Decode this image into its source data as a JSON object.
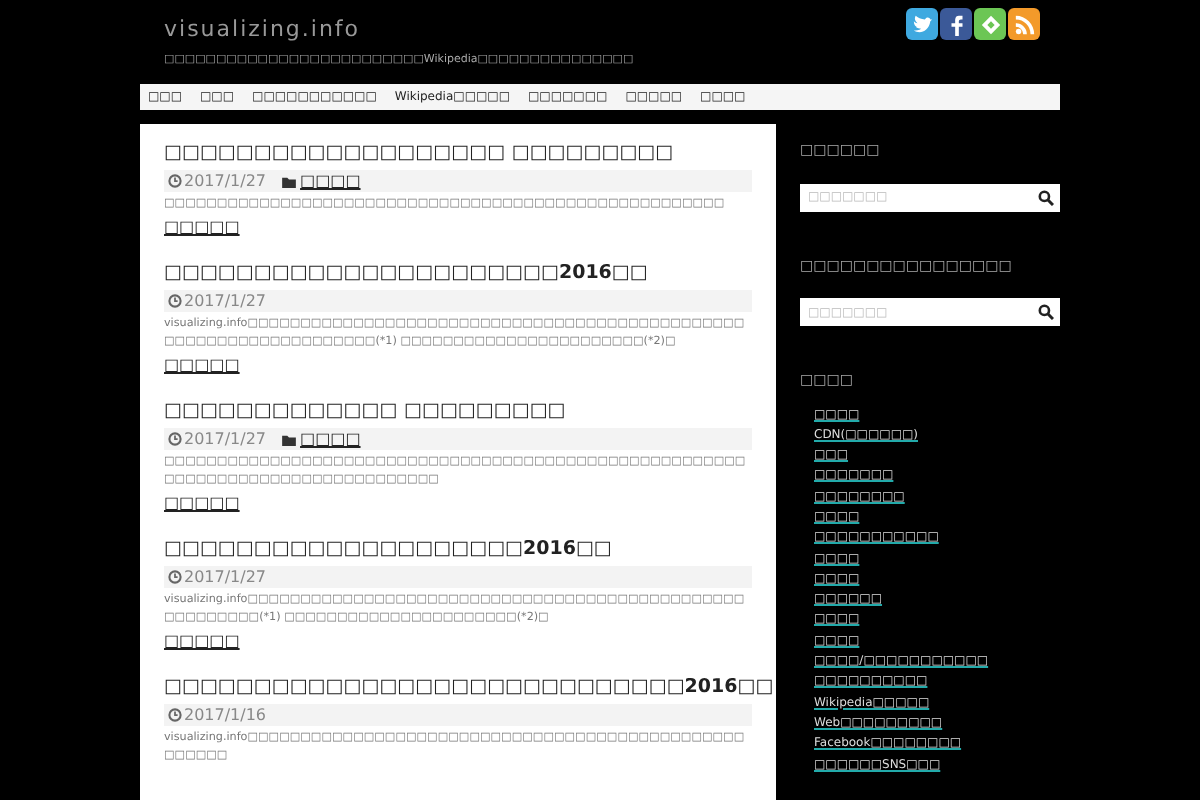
{
  "site": {
    "title": "visualizing.info",
    "tagline": "□□□□□□□□□□□□□□□□□□□□□□□□□Wikipedia□□□□□□□□□□□□□□□"
  },
  "social": [
    {
      "kind": "twitter"
    },
    {
      "kind": "facebook"
    },
    {
      "kind": "feedly"
    },
    {
      "kind": "rss"
    }
  ],
  "nav": [
    "□□□",
    "□□□",
    "□□□□□□□□□□□",
    "Wikipedia□□□□□",
    "□□□□□□□",
    "□□□□□",
    "□□□□"
  ],
  "posts": [
    {
      "title": "□□□□□□□□□□□□□□□□□□□ □□□□□□□□□",
      "date": "2017/1/27",
      "category": "□□□□",
      "excerpt": "□□□□□□□□□□□□□□□□□□□□□□□□□□□□□□□□□□□□□□□□□□□□□□□□□□□□□",
      "more": "□□□□□"
    },
    {
      "title": "□□□□□□□□□□□□□□□□□□□□□□2016□□",
      "date": "2017/1/27",
      "excerpt": "visualizing.info□□□□□□□□□□□□□□□□□□□□□□□□□□□□□□□□□□□□□□□□□□□□□□□□□□□□□□□□□□□□□□□□□□□(*1) □□□□□□□□□□□□□□□□□□□□□□□(*2)□",
      "more": "□□□□□"
    },
    {
      "title": "□□□□□□□□□□□□□ □□□□□□□□□",
      "date": "2017/1/27",
      "category": "□□□□",
      "excerpt": "□□□□□□□□□□□□□□□□□□□□□□□□□□□□□□□□□□□□□□□□□□□□□□□□□□□□□□□□□□□□□□□□□□□□□□□□□□□□□□□□□",
      "more": "□□□□□"
    },
    {
      "title": "□□□□□□□□□□□□□□□□□□□□2016□□",
      "date": "2017/1/27",
      "excerpt": "visualizing.info□□□□□□□□□□□□□□□□□□□□□□□□□□□□□□□□□□□□□□□□□□□□□□□□□□□□□□□□(*1) □□□□□□□□□□□□□□□□□□□□□□(*2)□",
      "more": "□□□□□"
    },
    {
      "title": "□□□□□□□□□□□□□□□□□□□□□□□□□□□□□2016□□",
      "date": "2017/1/16",
      "excerpt": "visualizing.info□□□□□□□□□□□□□□□□□□□□□□□□□□□□□□□□□□□□□□□□□□□□□□□□□□□□□"
    }
  ],
  "sidebar": {
    "widgets": [
      {
        "kind": "search",
        "title": "□□□□□□",
        "placeholder": "□□□□□□□"
      },
      {
        "kind": "search",
        "title": "□□□□□□□□□□□□□□□□",
        "placeholder": "□□□□□□□"
      },
      {
        "kind": "list",
        "title": "□□□□",
        "items": [
          "□□□□",
          "CDN(□□□□□□)",
          "□□□",
          "□□□□□□□",
          "□□□□□□□□",
          "□□□□",
          "□□□□□□□□□□□",
          "□□□□",
          "□□□□",
          "□□□□□□",
          "□□□□",
          "□□□□",
          "□□□□/□□□□□□□□□□□",
          "□□□□□□□□□□",
          "Wikipedia□□□□□",
          "Web□□□□□□□□□",
          "Facebook□□□□□□□□",
          "□□□□□□SNS□□□"
        ]
      }
    ]
  }
}
